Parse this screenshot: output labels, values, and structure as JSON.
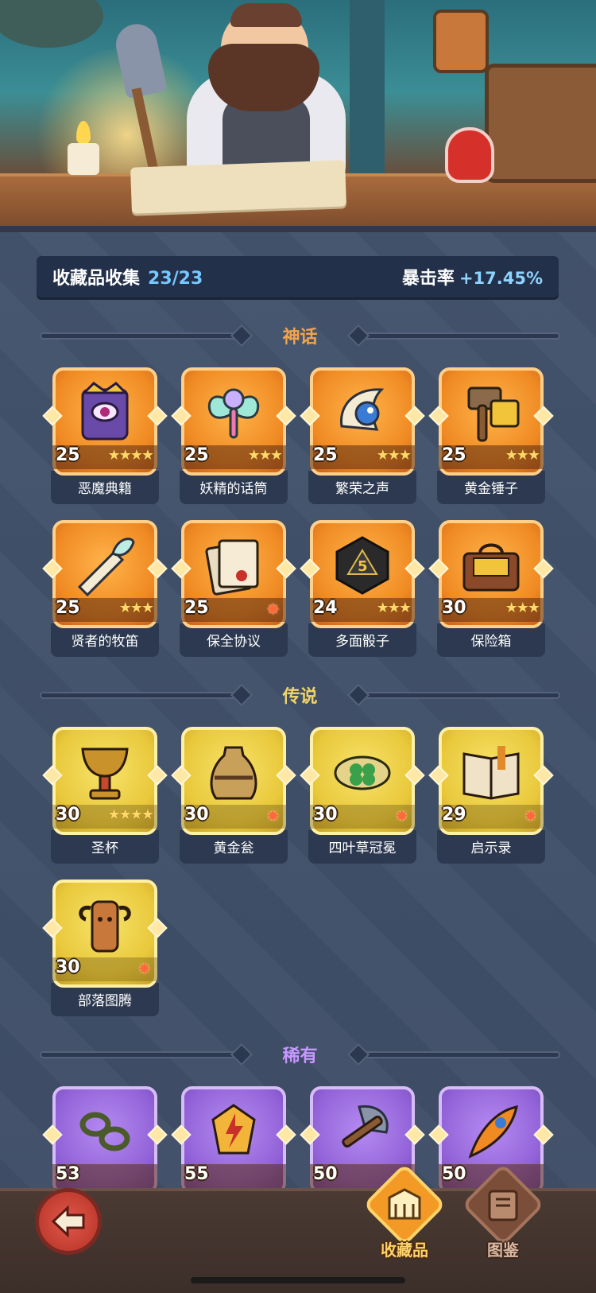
{
  "stats": {
    "collection_label": "收藏品收集",
    "collection_count": "23/23",
    "crit_label": "暴击率",
    "crit_value": "+17.45%"
  },
  "sections": {
    "mythic": {
      "title": "神话",
      "color": "#f3a44a"
    },
    "legendary": {
      "title": "传说",
      "color": "#f0d36a"
    },
    "rare": {
      "title": "稀有",
      "color": "#c697ff"
    }
  },
  "mythic_items": [
    {
      "name": "恶魔典籍",
      "level": "25",
      "stars": 4,
      "icon": "demon-book-icon"
    },
    {
      "name": "妖精的话筒",
      "level": "25",
      "stars": 3,
      "icon": "fairy-microphone-icon"
    },
    {
      "name": "繁荣之声",
      "level": "25",
      "stars": 3,
      "icon": "prosperity-horn-icon"
    },
    {
      "name": "黄金锤子",
      "level": "25",
      "stars": 3,
      "icon": "golden-hammer-icon"
    },
    {
      "name": "贤者的牧笛",
      "level": "25",
      "stars": 3,
      "icon": "sage-flute-icon"
    },
    {
      "name": "保全协议",
      "level": "25",
      "stars": 1,
      "icon": "security-contract-icon"
    },
    {
      "name": "多面骰子",
      "level": "24",
      "stars": 3,
      "icon": "polyhedral-dice-icon"
    },
    {
      "name": "保险箱",
      "level": "30",
      "stars": 3,
      "icon": "safe-box-icon"
    }
  ],
  "legendary_items": [
    {
      "name": "圣杯",
      "level": "30",
      "stars": 4,
      "icon": "holy-grail-icon"
    },
    {
      "name": "黄金瓮",
      "level": "30",
      "stars": 1,
      "icon": "golden-urn-icon"
    },
    {
      "name": "四叶草冠冕",
      "level": "30",
      "stars": 1,
      "icon": "clover-crown-icon"
    },
    {
      "name": "启示录",
      "level": "29",
      "stars": 1,
      "icon": "revelation-book-icon"
    },
    {
      "name": "部落图腾",
      "level": "30",
      "stars": 1,
      "icon": "tribal-totem-icon"
    }
  ],
  "rare_items": [
    {
      "name": "",
      "level": "53",
      "icon": "thorn-chain-icon"
    },
    {
      "name": "",
      "level": "55",
      "icon": "lightning-gem-icon"
    },
    {
      "name": "",
      "level": "50",
      "icon": "battle-axe-icon"
    },
    {
      "name": "",
      "level": "50",
      "icon": "fire-feather-icon"
    }
  ],
  "tabs": {
    "collection": "收藏品",
    "codex": "图鉴"
  }
}
